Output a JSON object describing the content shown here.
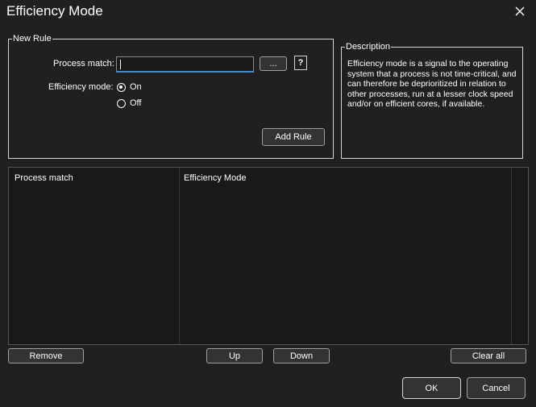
{
  "window": {
    "title": "Efficiency Mode"
  },
  "new_rule": {
    "legend": "New Rule",
    "process_match_label": "Process match:",
    "process_match_value": "",
    "browse_label": "...",
    "help_label": "?",
    "efficiency_mode_label": "Efficiency mode:",
    "options": [
      "On",
      "Off"
    ],
    "selected": "On",
    "add_rule_label": "Add Rule"
  },
  "description": {
    "legend": "Description",
    "text": "Efficiency mode is a signal to the operating system that a process is not time-critical, and can therefore be deprioritized in relation to other processes, run at a lesser clock speed and/or on efficient cores, if available."
  },
  "table": {
    "columns": [
      "Process match",
      "Efficiency Mode"
    ],
    "rows": []
  },
  "actions": {
    "remove": "Remove",
    "up": "Up",
    "down": "Down",
    "clear_all": "Clear all",
    "ok": "OK",
    "cancel": "Cancel"
  },
  "colors": {
    "accent": "#3b8fd9",
    "background": "#202020"
  }
}
